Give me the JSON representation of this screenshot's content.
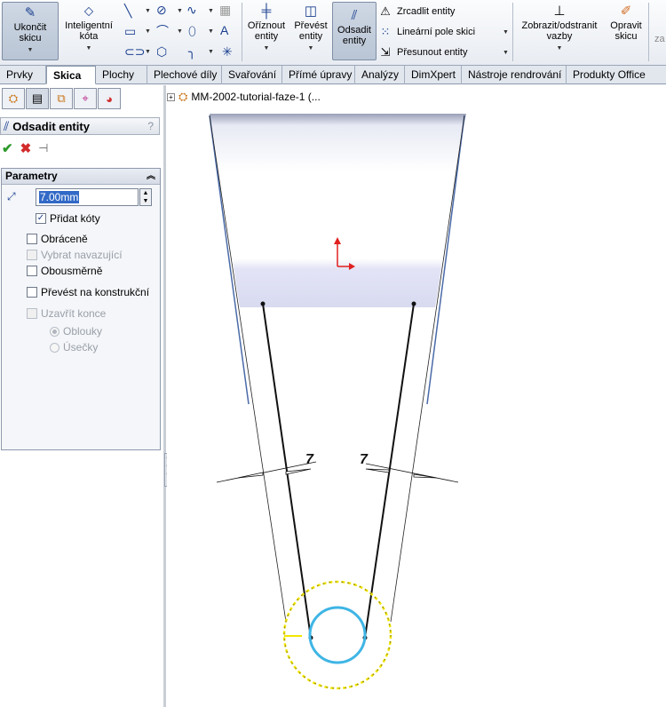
{
  "ribbon": {
    "exit_sketch": "Ukončit\nskicu",
    "smart_dimension": "Inteligentní\nkóta",
    "trim": "Oříznout\nentity",
    "convert": "Převést\nentity",
    "offset": "Odsadit\nentity",
    "mirror": "Zrcadlit entity",
    "linear_pattern": "Lineární pole skici",
    "move": "Přesunout entity",
    "show_relations": "Zobrazit/odstranit\nvazby",
    "repair": "Opravit\nskicu",
    "cut_label": "za"
  },
  "tabs": [
    "Prvky",
    "Skica",
    "Plochy",
    "Plechové díly",
    "Svařování",
    "Přímé úpravy",
    "Analýzy",
    "DimXpert",
    "Nástroje rendrování",
    "Produkty Office"
  ],
  "active_tab": "Skica",
  "panel": {
    "title": "Odsadit entity",
    "help": "?",
    "section": "Parametry",
    "distance": "7.00mm",
    "add_dims": "Přidat kóty",
    "reverse": "Obráceně",
    "select_chain": "Vybrat navazující",
    "bidirectional": "Obousměrně",
    "construction": "Převést na konstrukční",
    "cap_ends": "Uzavřít konce",
    "arcs": "Oblouky",
    "lines": "Úsečky"
  },
  "tree": {
    "document": "MM-2002-tutorial-faze-1  (..."
  },
  "sketch": {
    "dim_left": "7",
    "dim_right": "7",
    "accent": "#1a3f8f",
    "preview": "#f3e600",
    "highlight": "#3fb5e5"
  }
}
